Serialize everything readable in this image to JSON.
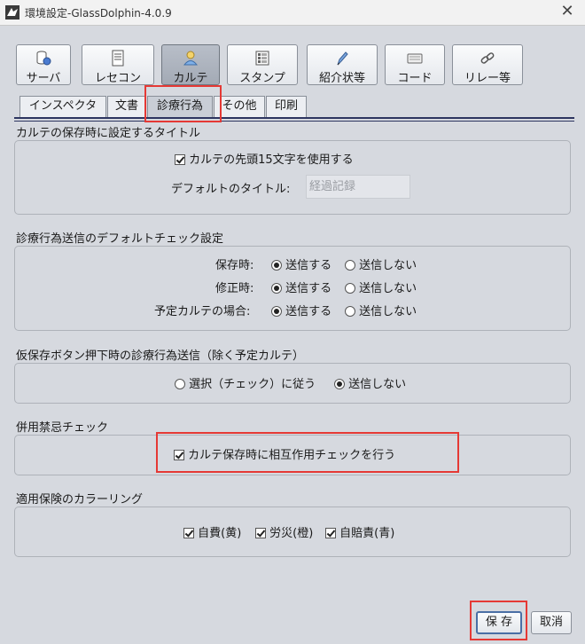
{
  "window": {
    "title": "環境設定-GlassDolphin-4.0.9",
    "close_glyph": "✕"
  },
  "categories": [
    {
      "label": "サーバ",
      "icon": "server-db-icon"
    },
    {
      "label": "レセコン",
      "icon": "document-icon"
    },
    {
      "label": "カルテ",
      "icon": "karte-person-icon",
      "selected": true
    },
    {
      "label": "スタンプ",
      "icon": "stamp-grid-icon"
    },
    {
      "label": "紹介状等",
      "icon": "pen-icon"
    },
    {
      "label": "コード",
      "icon": "keyboard-icon"
    },
    {
      "label": "リレー等",
      "icon": "link-chain-icon"
    }
  ],
  "tabs": [
    {
      "label": "インスペクタ"
    },
    {
      "label": "文書"
    },
    {
      "label": "診療行為",
      "selected": true
    },
    {
      "label": "その他"
    },
    {
      "label": "印刷"
    }
  ],
  "groups": {
    "title_setting": {
      "title": "カルテの保存時に設定するタイトル",
      "use_first15_label": "カルテの先頭15文字を使用する",
      "use_first15_checked": true,
      "default_title_label": "デフォルトのタイトル:",
      "default_title_value": "経過記録"
    },
    "default_send": {
      "title": "診療行為送信のデフォルトチェック設定",
      "rows": [
        {
          "label": "保存時:",
          "send": "送信する",
          "nosend": "送信しない",
          "selected": "send"
        },
        {
          "label": "修正時:",
          "send": "送信する",
          "nosend": "送信しない",
          "selected": "send"
        },
        {
          "label": "予定カルテの場合:",
          "send": "送信する",
          "nosend": "送信しない",
          "selected": "send"
        }
      ]
    },
    "temp_save": {
      "title": "仮保存ボタン押下時の診療行為送信（除く予定カルテ）",
      "opt1": "選択（チェック）に従う",
      "opt2": "送信しない",
      "selected": "opt2"
    },
    "interaction": {
      "title": "併用禁忌チェック",
      "check_label": "カルテ保存時に相互作用チェックを行う",
      "checked": true
    },
    "coloring": {
      "title": "適用保険のカラーリング",
      "items": [
        {
          "label": "自費(黄)",
          "checked": true
        },
        {
          "label": "労災(橙)",
          "checked": true
        },
        {
          "label": "自賠責(青)",
          "checked": true
        }
      ]
    }
  },
  "buttons": {
    "save": "保 存",
    "cancel": "取消"
  },
  "colors": {
    "highlight": "#e53935",
    "tab_rule": "#2d3560"
  }
}
